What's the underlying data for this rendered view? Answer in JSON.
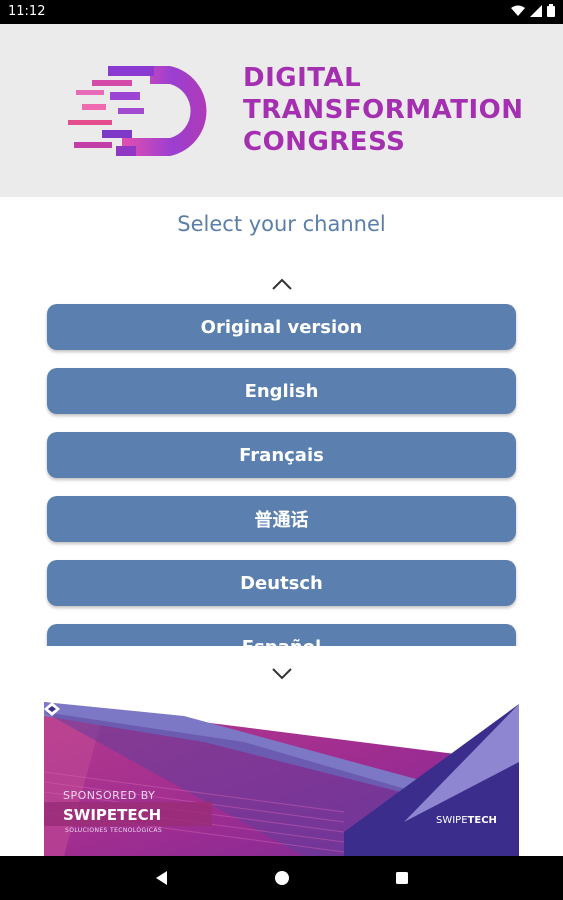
{
  "status_bar": {
    "time": "11:12",
    "icons": [
      "wifi-icon",
      "signal-icon",
      "battery-icon"
    ]
  },
  "header": {
    "logo_lines": [
      "DIGITAL",
      "TRANSFORMATION",
      "CONGRESS"
    ],
    "logo_color": "#a42fb0"
  },
  "main": {
    "title": "Select your channel",
    "channels": [
      {
        "label": "Original version"
      },
      {
        "label": "English"
      },
      {
        "label": "Français"
      },
      {
        "label": "普通话"
      },
      {
        "label": "Deutsch"
      },
      {
        "label": "Español"
      }
    ],
    "button_color": "#5b7fae"
  },
  "banner": {
    "sponsored_by": "SPONSORED BY",
    "sponsor_name": "SWIPETECH",
    "sponsor_tagline": "SOLUCIONES TECNOLÓGICAS",
    "logo_text_light": "SWIPE",
    "logo_text_bold": "TECH"
  },
  "nav_bar": {
    "buttons": [
      "back-icon",
      "home-icon",
      "recents-icon"
    ]
  }
}
